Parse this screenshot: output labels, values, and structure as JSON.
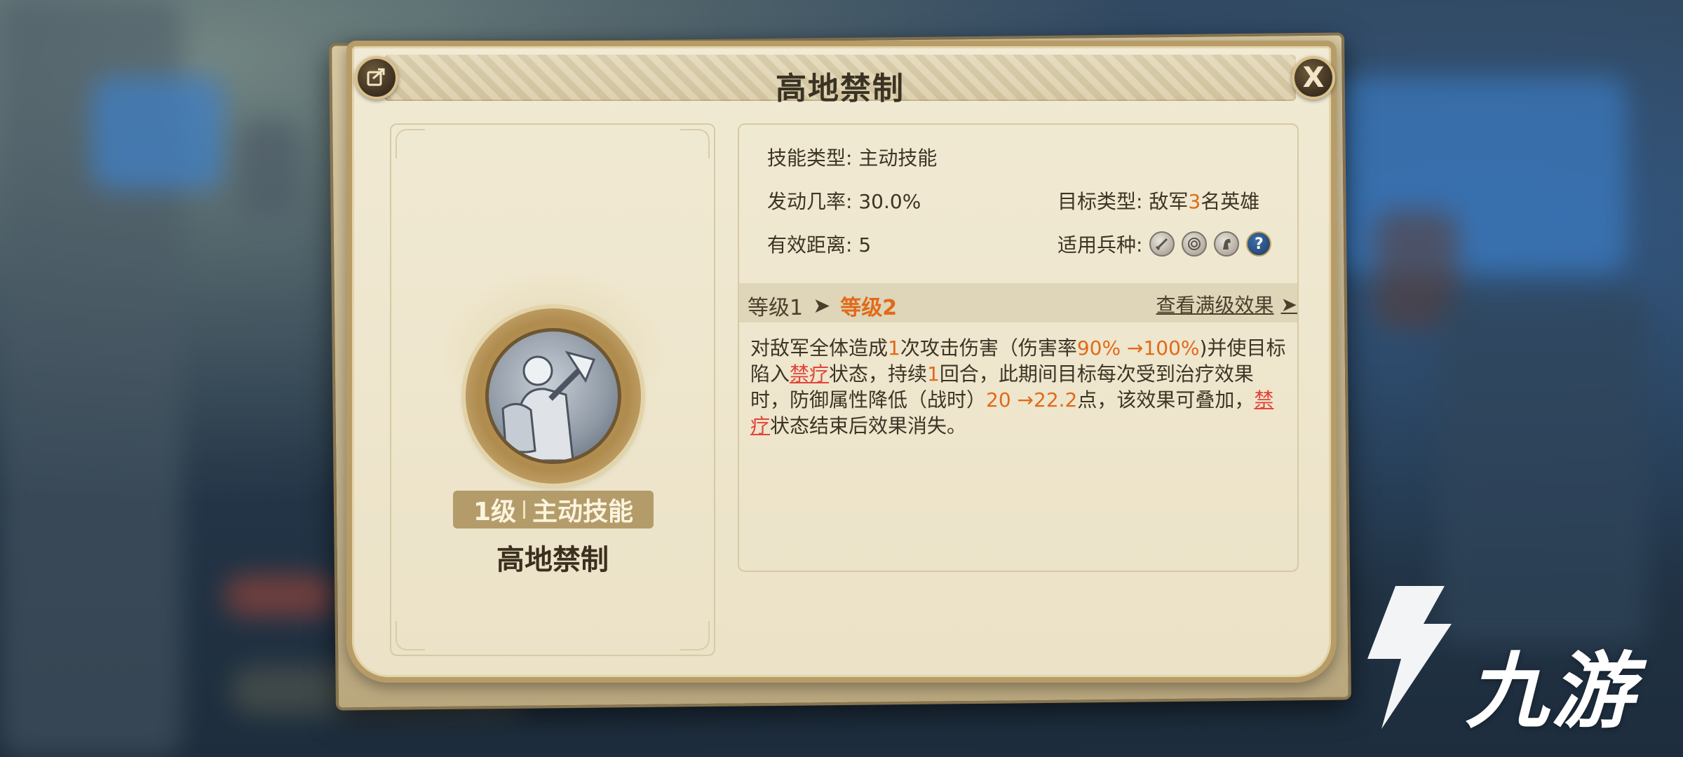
{
  "dialog": {
    "title": "高地禁制",
    "close_label": "X"
  },
  "skill": {
    "level_label": "1级",
    "kind_label": "主动技能",
    "name": "高地禁制"
  },
  "info": {
    "type_label": "技能类型:",
    "type_value": "主动技能",
    "rate_label": "发动几率:",
    "rate_value": "30.0%",
    "range_label": "有效距离:",
    "range_value": "5",
    "target_label": "目标类型:",
    "target_prefix": "敌军",
    "target_count": "3",
    "target_suffix": "名英雄",
    "troops_label": "适用兵种:",
    "troop_icons": [
      "sword-troop-icon",
      "bow-troop-icon",
      "cavalry-troop-icon",
      "unknown-troop-icon"
    ],
    "troop_question": "?"
  },
  "levels": {
    "level1": "等级1",
    "arrow": "➤",
    "level2": "等级2",
    "view_full": "查看满级效果",
    "view_arrow": "➤"
  },
  "description": {
    "p1": "对敌军全体造成",
    "n1": "1",
    "p2": "次攻击伤害（伤害率",
    "n2": "90% →100%",
    "p3": ")并使目标陷入",
    "status1": "禁疗",
    "p4": "状态，持续",
    "n3": "1",
    "p5": "回合，此期间目标每次受到治疗效果时，防御属性降低（战时）",
    "n4": "20 →22.2",
    "p6": "点，该效果可叠加，",
    "status2": "禁疗",
    "p7": "状态结束后效果消失。"
  },
  "watermark": {
    "text": "九游"
  },
  "colors": {
    "highlight": "#e06a1a",
    "status_red": "#e2443a",
    "parchment": "#eee6cd",
    "frame_gold": "#b79c67"
  }
}
